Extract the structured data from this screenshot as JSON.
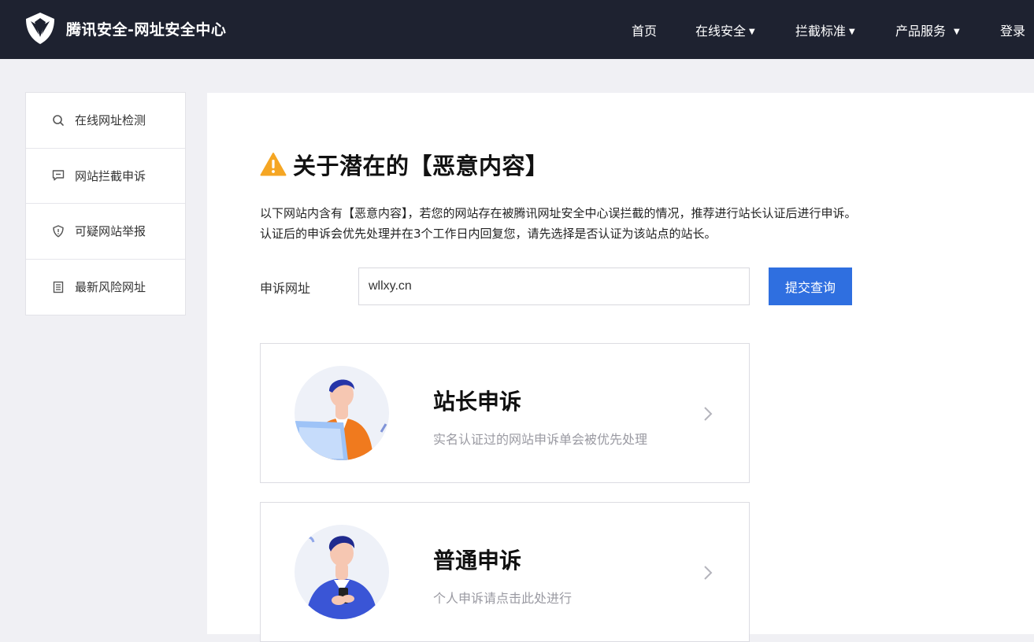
{
  "header": {
    "brand_title": "腾讯安全-网址安全中心",
    "nav": [
      {
        "label": "首页",
        "has_caret": false
      },
      {
        "label": "在线安全",
        "has_caret": true
      },
      {
        "label": "拦截标准",
        "has_caret": true
      },
      {
        "label": "产品服务",
        "has_caret": true
      },
      {
        "label": "登录",
        "has_caret": false
      }
    ],
    "caret": "▼"
  },
  "sidebar": {
    "items": [
      {
        "label": "在线网址检测",
        "icon": "search-icon"
      },
      {
        "label": "网站拦截申诉",
        "icon": "chat-icon"
      },
      {
        "label": "可疑网站举报",
        "icon": "shield-icon"
      },
      {
        "label": "最新风险网址",
        "icon": "document-icon"
      }
    ]
  },
  "main": {
    "heading": "关于潜在的【恶意内容】",
    "desc_line1": "以下网站内含有【恶意内容】，若您的网站存在被腾讯网址安全中心误拦截的情况，推荐进行站长认证后进行申诉。",
    "desc_line2": "认证后的申诉会优先处理并在3个工作日内回复您，请先选择是否认证为该站点的站长。",
    "form": {
      "label": "申诉网址",
      "url_value": "wllxy.cn",
      "submit_label": "提交查询"
    },
    "cards": [
      {
        "title": "站长申诉",
        "subtitle": "实名认证过的网站申诉单会被优先处理"
      },
      {
        "title": "普通申诉",
        "subtitle": "个人申诉请点击此处进行"
      }
    ]
  },
  "colors": {
    "topbar": "#1e2230",
    "accent_blue": "#2f6fe0",
    "warning": "#f5a623",
    "page_bg": "#f0f0f4"
  }
}
